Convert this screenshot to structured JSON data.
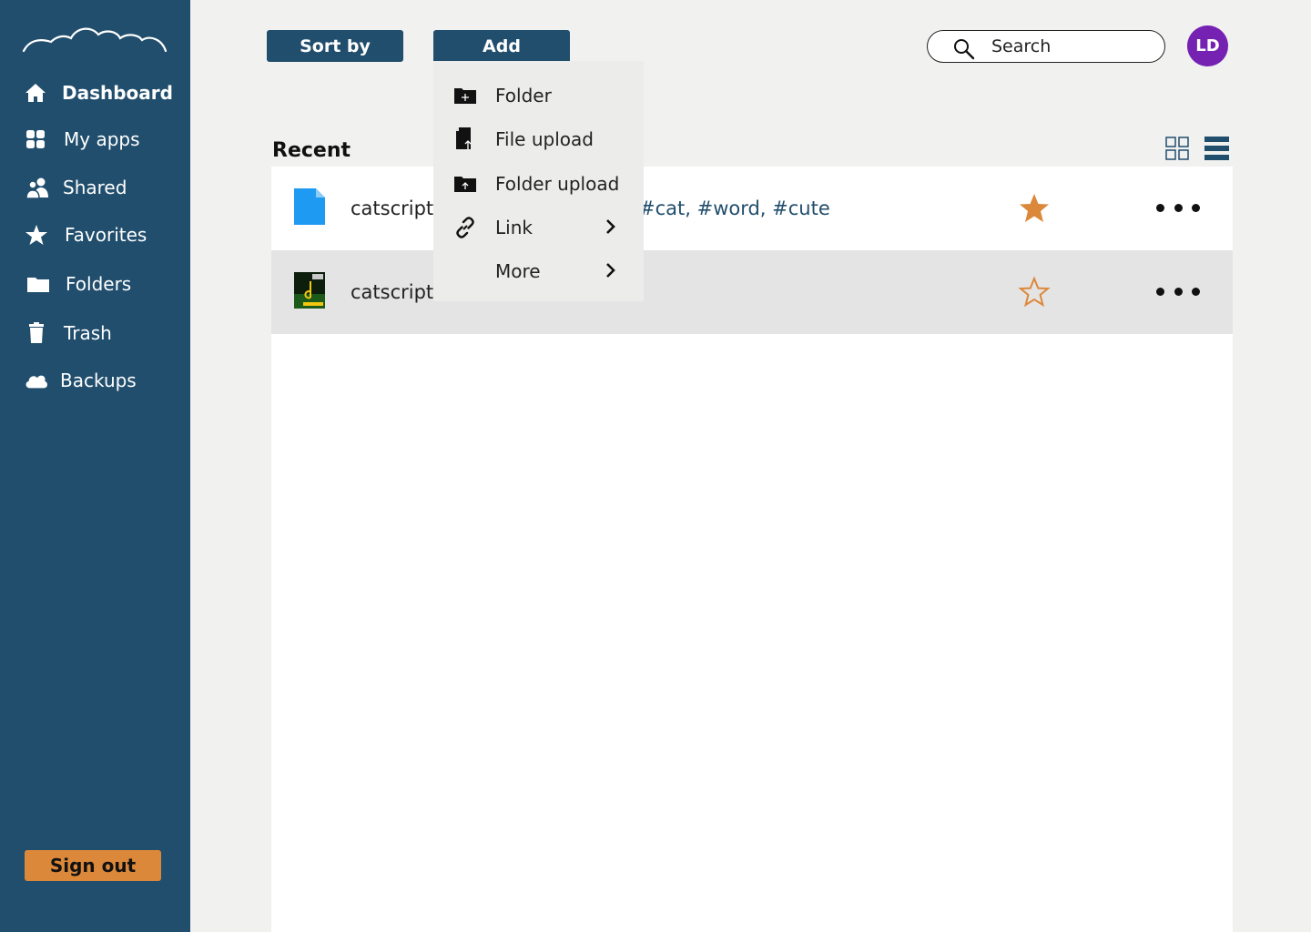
{
  "sidebar": {
    "items": [
      {
        "label": "Dashboard",
        "icon": "home-icon"
      },
      {
        "label": "My apps",
        "icon": "apps-grid-icon"
      },
      {
        "label": "Shared",
        "icon": "people-icon"
      },
      {
        "label": "Favorites",
        "icon": "star-icon"
      },
      {
        "label": "Folders",
        "icon": "folder-icon"
      },
      {
        "label": "Trash",
        "icon": "trash-icon"
      },
      {
        "label": "Backups",
        "icon": "cloud-icon"
      }
    ],
    "signout_label": "Sign out"
  },
  "toolbar": {
    "sort_label": "Sort by",
    "add_label": "Add"
  },
  "search": {
    "placeholder": "Search"
  },
  "user": {
    "initials": "LD",
    "avatar_color": "#7522b3"
  },
  "add_menu": {
    "items": [
      {
        "label": "Folder",
        "icon": "new-folder-icon"
      },
      {
        "label": "File upload",
        "icon": "file-upload-icon"
      },
      {
        "label": "Folder upload",
        "icon": "folder-upload-icon"
      },
      {
        "label": "Link",
        "icon": "link-icon",
        "submenu": true
      },
      {
        "label": "More",
        "icon": "",
        "submenu": true
      }
    ]
  },
  "main": {
    "section_title": "Recent",
    "files": [
      {
        "name": "catscript.c",
        "tags": "#cat, #word, #cute",
        "favorite": true,
        "icon": "document-icon"
      },
      {
        "name": "catscript.doc",
        "tags": "",
        "favorite": false,
        "icon": "thumbnail-image"
      }
    ]
  },
  "colors": {
    "sidebar": "#214e6d",
    "accent": "#dc883a",
    "background": "#f1f1f0"
  }
}
